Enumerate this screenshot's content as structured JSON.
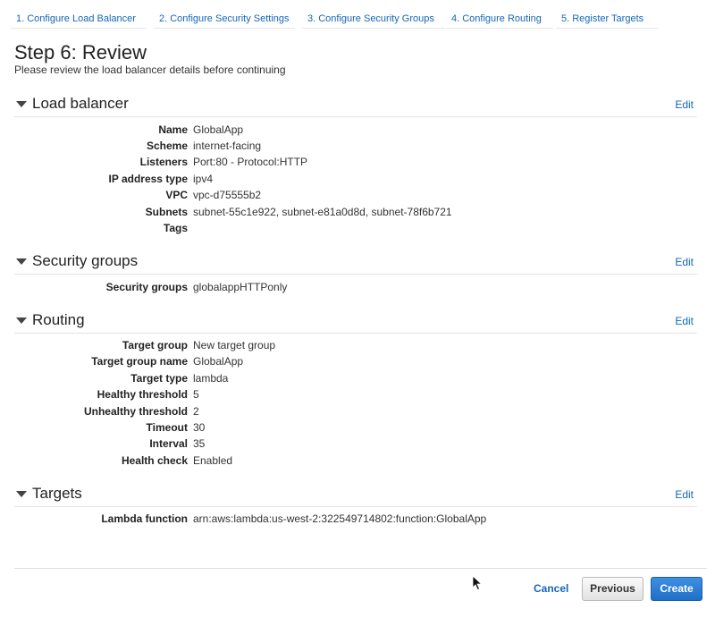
{
  "tabs": [
    "1. Configure Load Balancer",
    "2. Configure Security Settings",
    "3. Configure Security Groups",
    "4. Configure Routing",
    "5. Register Targets"
  ],
  "page": {
    "title": "Step 6: Review",
    "subtitle": "Please review the load balancer details before continuing"
  },
  "sections": {
    "load_balancer": {
      "title": "Load balancer",
      "edit": "Edit",
      "rows": [
        {
          "k": "Name",
          "v": "GlobalApp"
        },
        {
          "k": "Scheme",
          "v": "internet-facing"
        },
        {
          "k": "Listeners",
          "v": "Port:80 - Protocol:HTTP"
        },
        {
          "k": "IP address type",
          "v": "ipv4"
        },
        {
          "k": "VPC",
          "v": "vpc-d75555b2"
        },
        {
          "k": "Subnets",
          "v": "subnet-55c1e922, subnet-e81a0d8d, subnet-78f6b721"
        },
        {
          "k": "Tags",
          "v": ""
        }
      ]
    },
    "security_groups": {
      "title": "Security groups",
      "edit": "Edit",
      "rows": [
        {
          "k": "Security groups",
          "v": "globalappHTTPonly"
        }
      ]
    },
    "routing": {
      "title": "Routing",
      "edit": "Edit",
      "rows": [
        {
          "k": "Target group",
          "v": "New target group"
        },
        {
          "k": "Target group name",
          "v": "GlobalApp"
        },
        {
          "k": "Target type",
          "v": "lambda"
        },
        {
          "k": "Healthy threshold",
          "v": "5"
        },
        {
          "k": "Unhealthy threshold",
          "v": "2"
        },
        {
          "k": "Timeout",
          "v": "30"
        },
        {
          "k": "Interval",
          "v": "35"
        },
        {
          "k": "Health check",
          "v": "Enabled"
        }
      ]
    },
    "targets": {
      "title": "Targets",
      "edit": "Edit",
      "rows": [
        {
          "k": "Lambda function",
          "v": "arn:aws:lambda:us-west-2:322549714802:function:GlobalApp"
        }
      ]
    }
  },
  "footer": {
    "cancel": "Cancel",
    "previous": "Previous",
    "create": "Create"
  }
}
